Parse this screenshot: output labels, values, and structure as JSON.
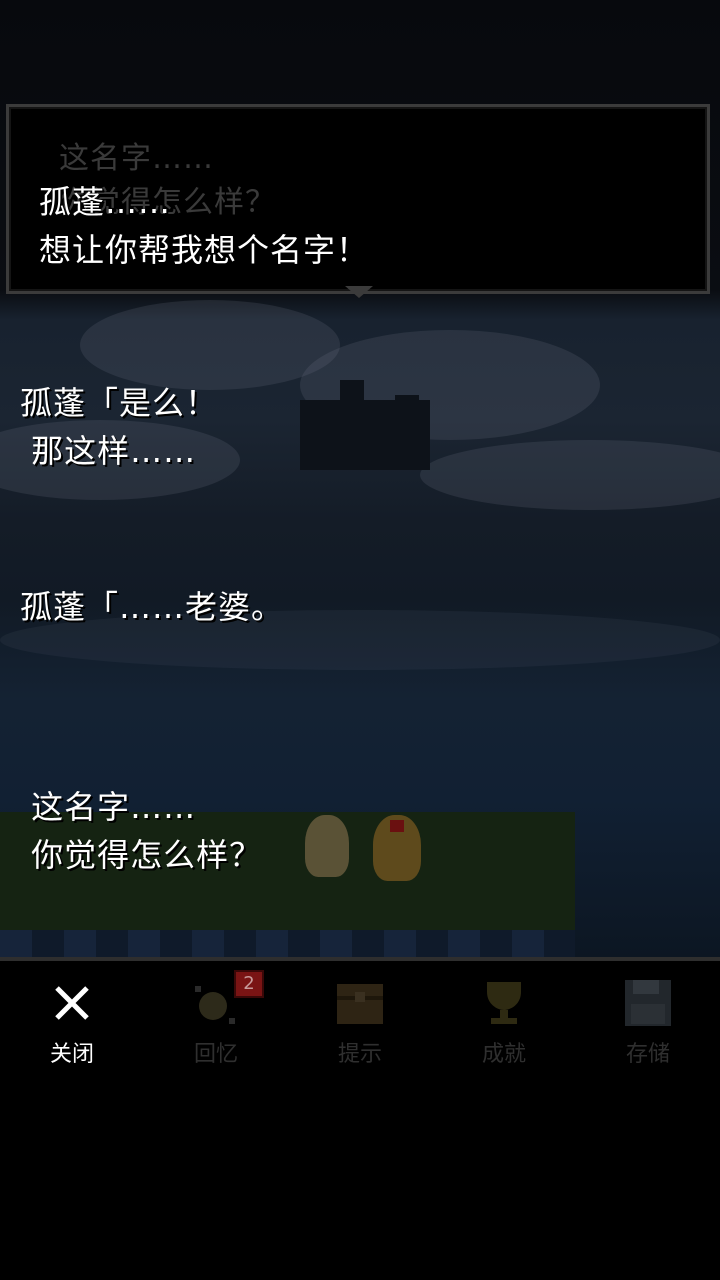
{
  "dialog": {
    "ghost_lines": [
      "这名字……",
      "你觉得怎么样？"
    ],
    "speaker": "孤蓬……",
    "line": "想让你帮我想个名字！"
  },
  "log": [
    {
      "lines": [
        "孤蓬「是么！",
        " 那这样……"
      ]
    },
    {
      "lines": [
        "孤蓬「……老婆。"
      ]
    },
    {
      "lines": [
        " 这名字……",
        " 你觉得怎么样？"
      ]
    }
  ],
  "tabs": [
    {
      "label": "关闭",
      "icon": "close-icon",
      "active": true
    },
    {
      "label": "回忆",
      "icon": "memory-icon",
      "badge": "2"
    },
    {
      "label": "提示",
      "icon": "treasure-chest-icon"
    },
    {
      "label": "成就",
      "icon": "trophy-icon"
    },
    {
      "label": "存储",
      "icon": "floppy-disk-icon"
    }
  ]
}
